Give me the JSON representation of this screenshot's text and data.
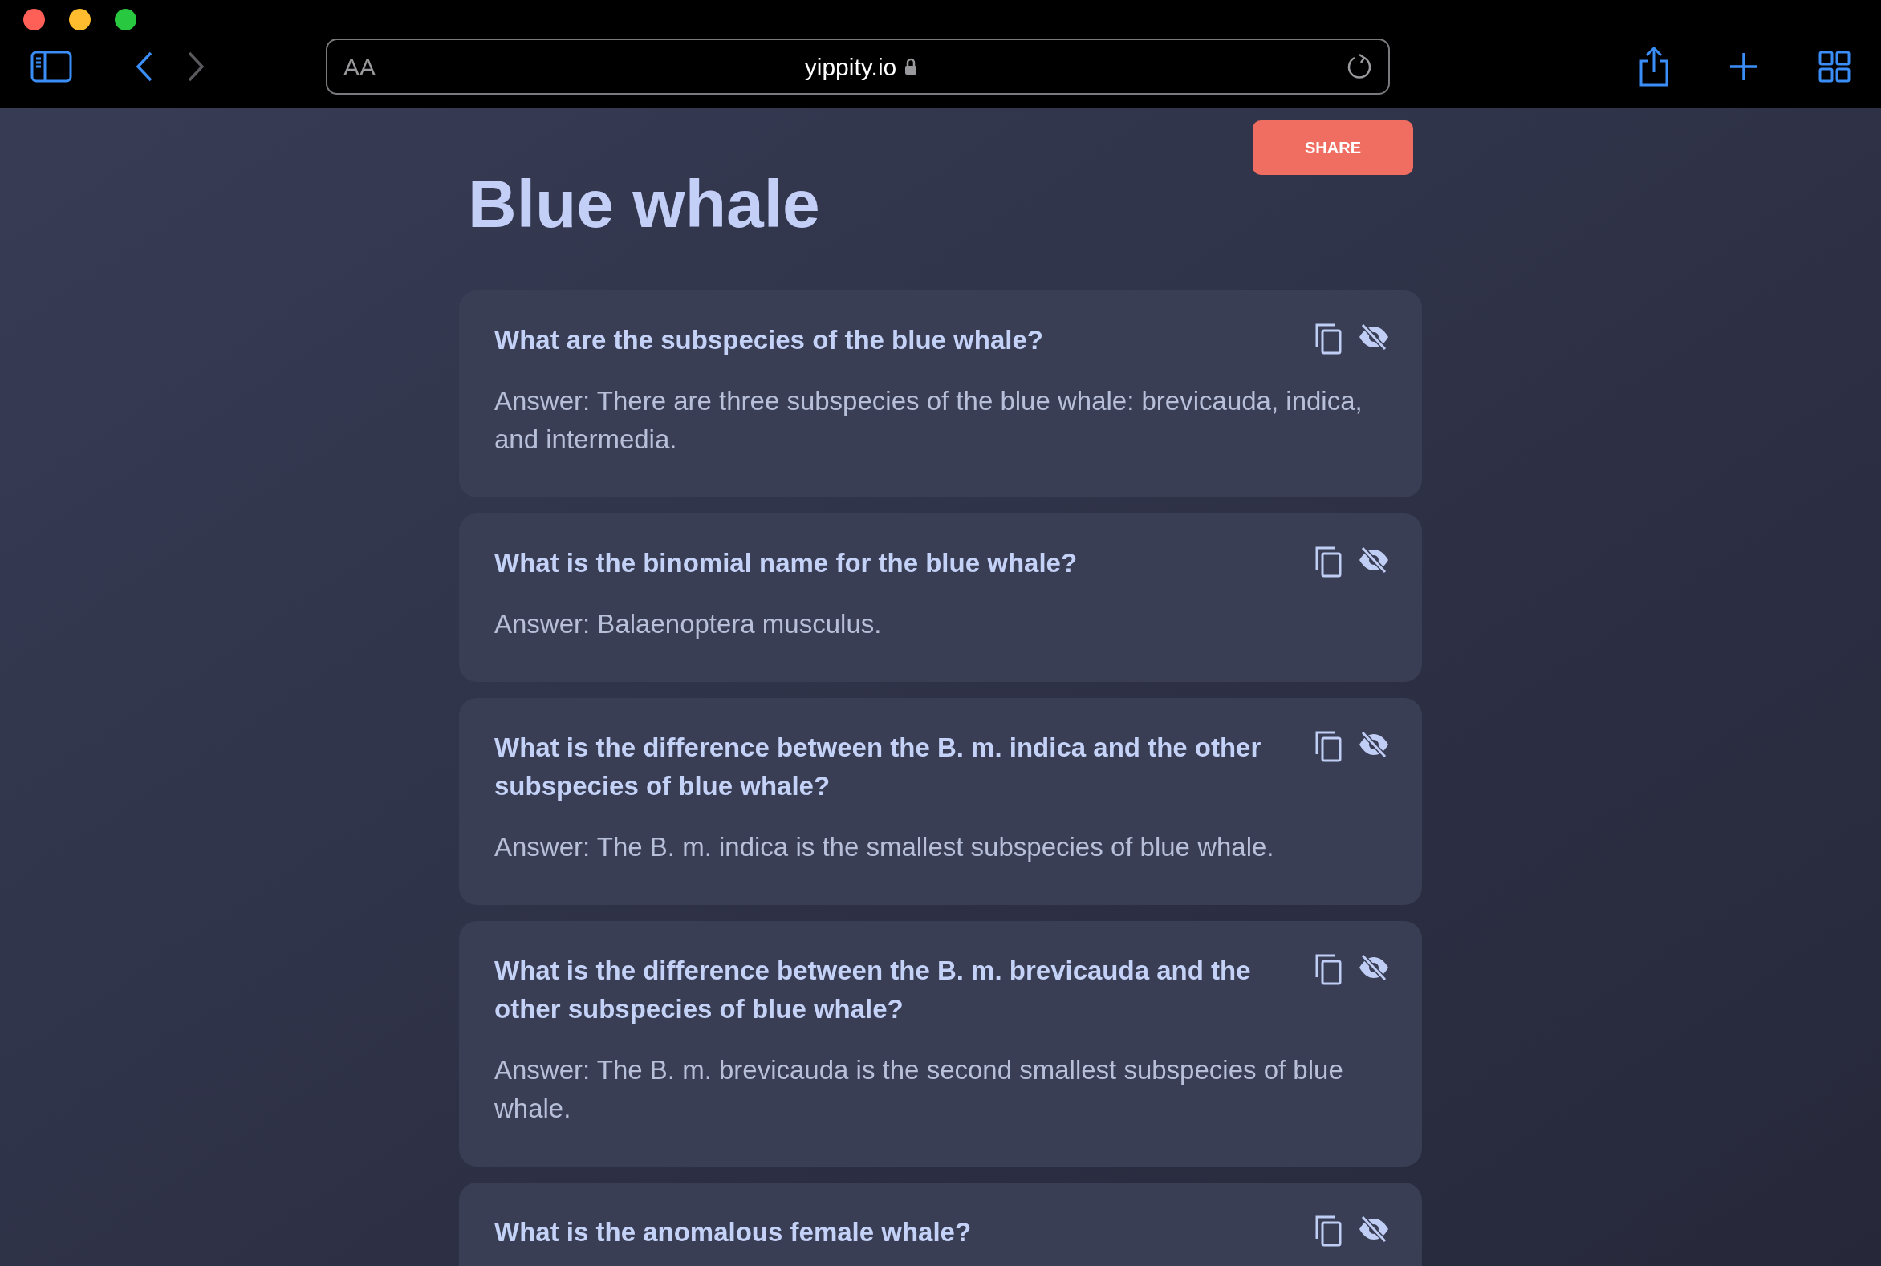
{
  "browser": {
    "text_size_label": "AA",
    "url": "yippity.io",
    "forward_disabled": true
  },
  "share_button": "SHARE",
  "title": "Blue whale",
  "cards": [
    {
      "question": "What are the subspecies of the blue whale?",
      "answer": "Answer: There are three subspecies of the blue whale: brevicauda, indica, and intermedia."
    },
    {
      "question": "What is the binomial name for the blue whale?",
      "answer": "Answer: Balaenoptera musculus."
    },
    {
      "question": "What is the difference between the B. m. indica and the other subspecies of blue whale?",
      "answer": "Answer: The B. m. indica is the smallest subspecies of blue whale."
    },
    {
      "question": "What is the difference between the B. m. brevicauda and the other subspecies of blue whale?",
      "answer": "Answer: The B. m. brevicauda is the second smallest subspecies of blue whale."
    },
    {
      "question": "What is the anomalous female whale?"
    }
  ]
}
